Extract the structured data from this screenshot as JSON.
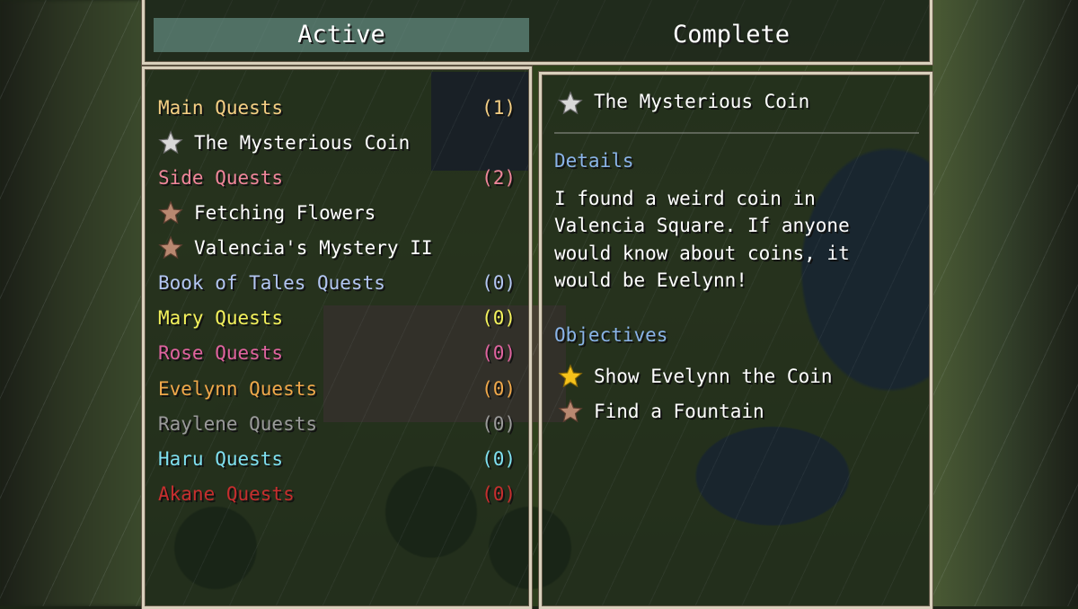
{
  "tabs": {
    "active_label": "Active",
    "complete_label": "Complete"
  },
  "categories": [
    {
      "label": "Main Quests",
      "count": "(1)",
      "color": "#f5cf84"
    },
    {
      "label": "Side Quests",
      "count": "(2)",
      "color": "#f0869a"
    },
    {
      "label": "Book of Tales Quests",
      "count": "(0)",
      "color": "#b3c6f2"
    },
    {
      "label": "Mary Quests",
      "count": "(0)",
      "color": "#f4f25c"
    },
    {
      "label": "Rose Quests",
      "count": "(0)",
      "color": "#e0639f"
    },
    {
      "label": "Evelynn Quests",
      "count": "(0)",
      "color": "#f0a84a"
    },
    {
      "label": "Raylene Quests",
      "count": "(0)",
      "color": "#9a9a9a"
    },
    {
      "label": "Haru Quests",
      "count": "(0)",
      "color": "#7fe0f0"
    },
    {
      "label": "Akane Quests",
      "count": "(0)",
      "color": "#c62e2e"
    }
  ],
  "quests": {
    "main": [
      {
        "label": "The Mysterious Coin",
        "icon": "silver-star-icon"
      }
    ],
    "side": [
      {
        "label": "Fetching Flowers",
        "icon": "bronze-star-icon"
      },
      {
        "label": "Valencia's Mystery II",
        "icon": "bronze-star-icon"
      }
    ]
  },
  "detail": {
    "title": "The Mysterious Coin",
    "title_icon": "silver-star-icon",
    "details_heading": "Details",
    "description_lines": [
      "I found a weird coin in",
      "Valencia Square. If anyone",
      "would know about coins, it",
      "would be Evelynn!"
    ],
    "objectives_heading": "Objectives",
    "objectives": [
      {
        "label": "Show Evelynn the Coin",
        "icon": "gold-star-icon"
      },
      {
        "label": "Find a Fountain",
        "icon": "bronze-star-icon"
      }
    ]
  },
  "colors": {
    "heading_blue": "#8ab4e8",
    "star_silver": "#d8d8d8",
    "star_bronze": "#b88870",
    "star_gold": "#f5c21a"
  }
}
